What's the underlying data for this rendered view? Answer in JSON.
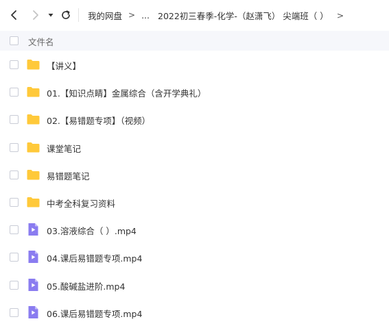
{
  "toolbar": {
    "back_icon": "chevron-left-icon",
    "forward_icon": "chevron-right-icon",
    "history_icon": "caret-down-icon",
    "refresh_icon": "refresh-icon"
  },
  "breadcrumb": {
    "root": "我的网盘",
    "separator": ">",
    "ellipsis": "...",
    "current": "2022初三春季-化学-（赵潇飞） 尖端班（ ）",
    "trailing_separator": ">"
  },
  "list_header": {
    "name_column": "文件名"
  },
  "colors": {
    "folder": "#ffc93b",
    "video": "#8a7cf0",
    "header_bg": "#f6f7fb"
  },
  "files": [
    {
      "name": "【讲义】",
      "type": "folder",
      "icon": "folder-icon"
    },
    {
      "name": "01.【知识点睛】金属综合（含开学典礼）",
      "type": "folder",
      "icon": "folder-icon"
    },
    {
      "name": "02.【易错题专项】（视频）",
      "type": "folder",
      "icon": "folder-icon"
    },
    {
      "name": "课堂笔记",
      "type": "folder",
      "icon": "folder-icon"
    },
    {
      "name": "易错题笔记",
      "type": "folder",
      "icon": "folder-icon"
    },
    {
      "name": "中考全科复习资料",
      "type": "folder",
      "icon": "folder-icon"
    },
    {
      "name": "03.溶液综合（ ）.mp4",
      "type": "video",
      "icon": "video-file-icon"
    },
    {
      "name": "04.课后易错题专项.mp4",
      "type": "video",
      "icon": "video-file-icon"
    },
    {
      "name": "05.酸碱盐进阶.mp4",
      "type": "video",
      "icon": "video-file-icon"
    },
    {
      "name": "06.课后易错题专项.mp4",
      "type": "video",
      "icon": "video-file-icon"
    }
  ]
}
